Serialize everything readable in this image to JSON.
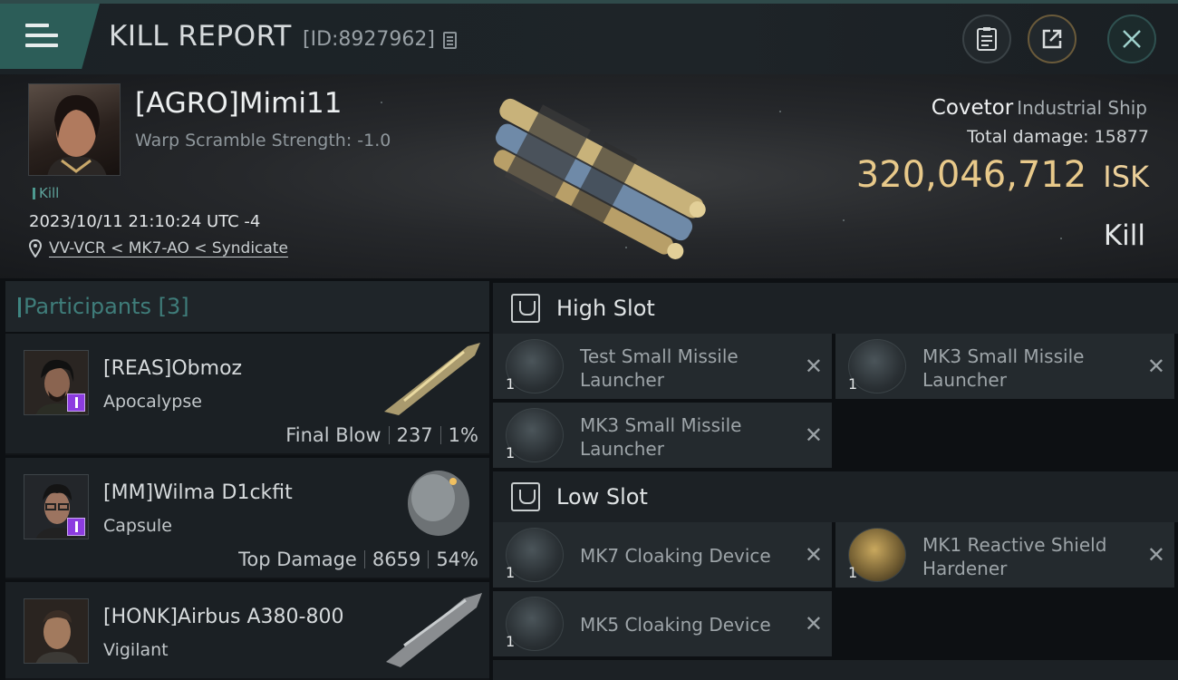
{
  "header": {
    "title": "KILL REPORT",
    "report_id": "[ID:8927962]",
    "icons": [
      "menu-icon",
      "copy-icon",
      "notes-icon",
      "share-icon",
      "close-icon"
    ]
  },
  "victim": {
    "name": "[AGRO]Mimi11",
    "warp_scramble": "Warp Scramble Strength: -1.0",
    "kill_tag": "Kill",
    "datetime": "2023/10/11 21:10:24 UTC -4",
    "location": "VV-VCR < MK7-AO < Syndicate",
    "ship_name": "Covetor",
    "ship_class": "Industrial Ship",
    "total_damage_label": "Total damage:",
    "total_damage": "15877",
    "isk_value": "320,046,712",
    "isk_unit": "ISK",
    "result": "Kill"
  },
  "participants": {
    "label": "Participants",
    "count": "[3]",
    "items": [
      {
        "name": "[REAS]Obmoz",
        "ship": "Apocalypse",
        "role": "Final Blow",
        "damage": "237",
        "percent": "1%"
      },
      {
        "name": "[MM]Wilma D1ckfit",
        "ship": "Capsule",
        "role": "Top Damage",
        "damage": "8659",
        "percent": "54%"
      },
      {
        "name": "[HONK]Airbus A380-800",
        "ship": "Vigilant",
        "role": "",
        "damage": "",
        "percent": ""
      }
    ]
  },
  "slots": {
    "high": {
      "label": "High Slot",
      "modules": [
        {
          "name": "Test Small Missile Launcher",
          "qty": "1"
        },
        {
          "name": "MK3 Small Missile Launcher",
          "qty": "1"
        },
        {
          "name": "MK3 Small Missile Launcher",
          "qty": "1"
        }
      ]
    },
    "low": {
      "label": "Low Slot",
      "modules": [
        {
          "name": "MK7 Cloaking Device",
          "qty": "1"
        },
        {
          "name": "MK1 Reactive Shield Hardener",
          "qty": "1"
        },
        {
          "name": "MK5 Cloaking Device",
          "qty": "1"
        }
      ]
    },
    "remove_symbol": "✕"
  }
}
